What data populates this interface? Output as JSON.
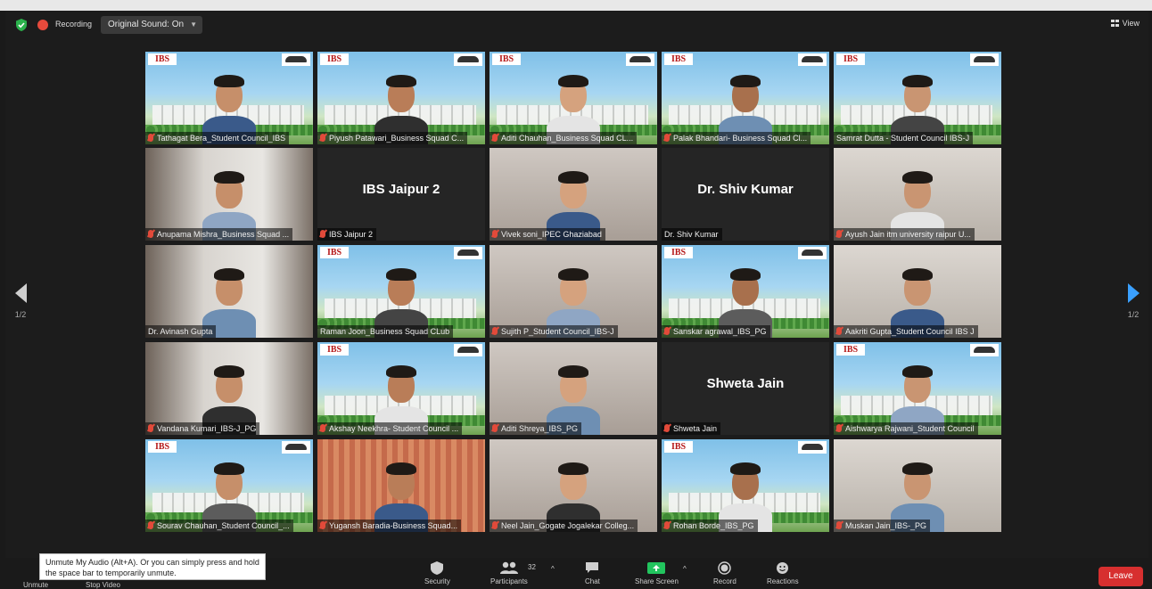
{
  "topbar": {
    "recording_label": "Recording",
    "sound_label": "Original Sound: On",
    "view_label": "View"
  },
  "pagination": {
    "left": "1/2",
    "right": "1/2"
  },
  "participants": [
    {
      "name": "Tathagat Bera_Student Council_IBS",
      "bg": "campus",
      "muted": true
    },
    {
      "name": "Piyush Patawari_Business Squad C...",
      "bg": "campus",
      "muted": true
    },
    {
      "name": "Aditi Chauhan_Business Squad CL...",
      "bg": "campus",
      "muted": true
    },
    {
      "name": "Palak Bhandari- Business Squad Cl...",
      "bg": "campus",
      "muted": true
    },
    {
      "name": "Samrat Dutta - Student Council IBS-J",
      "bg": "campus",
      "muted": false
    },
    {
      "name": "Anupama Mishra_Business Squad ...",
      "bg": "room",
      "muted": true
    },
    {
      "name": "IBS Jaipur 2",
      "bg": "dark",
      "display": "IBS Jaipur 2",
      "muted": true
    },
    {
      "name": "Vivek soni_IPEC Ghaziabad",
      "bg": "room",
      "muted": true
    },
    {
      "name": "Dr. Shiv Kumar",
      "bg": "dark",
      "display": "Dr. Shiv Kumar",
      "muted": false
    },
    {
      "name": "Ayush Jain itm university  raipur U...",
      "bg": "room",
      "muted": true
    },
    {
      "name": "Dr. Avinash Gupta",
      "bg": "room",
      "muted": false
    },
    {
      "name": "Raman Joon_Business Squad CLub",
      "bg": "campus",
      "muted": false,
      "active": true
    },
    {
      "name": "Sujith P_Student Council_IBS-J",
      "bg": "room",
      "muted": true
    },
    {
      "name": "Sanskar agrawal_IBS_PG",
      "bg": "campus",
      "muted": true
    },
    {
      "name": "Aakriti Gupta_Student Council IBS J",
      "bg": "room",
      "muted": true
    },
    {
      "name": "Vandana Kumari_IBS-J_PG",
      "bg": "room",
      "muted": true
    },
    {
      "name": "Akshay Neekhra- Student Council ...",
      "bg": "campus",
      "muted": true
    },
    {
      "name": "Aditi Shreya_IBS_PG",
      "bg": "room",
      "muted": true
    },
    {
      "name": "Shweta Jain",
      "bg": "dark",
      "display": "Shweta Jain",
      "muted": true
    },
    {
      "name": "Aishwarya Rajwani_Student Council",
      "bg": "campus",
      "muted": true
    },
    {
      "name": "Sourav Chauhan_Student Council_...",
      "bg": "campus",
      "muted": true
    },
    {
      "name": "Yugansh Baradia-Business Squad...",
      "bg": "palace",
      "muted": true
    },
    {
      "name": "Neel Jain_Gogate Jogalekar Colleg...",
      "bg": "room",
      "muted": true
    },
    {
      "name": "Rohan Borde_IBS_PG",
      "bg": "campus",
      "muted": true
    },
    {
      "name": "Muskan Jain_IBS-_PG",
      "bg": "room",
      "muted": true
    }
  ],
  "logo_text": "IBS",
  "tooltip": "Unmute My Audio (Alt+A). Or you can simply press and hold the space bar to temporarily unmute.",
  "toolbar": {
    "unmute": "Unmute",
    "stop_video": "Stop Video",
    "security": "Security",
    "participants": "Participants",
    "participants_count": "32",
    "chat": "Chat",
    "share_screen": "Share Screen",
    "record": "Record",
    "reactions": "Reactions",
    "leave": "Leave"
  },
  "colors": {
    "accent_blue": "#3aa0ff",
    "leave_red": "#d72f2f",
    "share_green": "#22c55e",
    "active_speaker": "#d9d233"
  }
}
